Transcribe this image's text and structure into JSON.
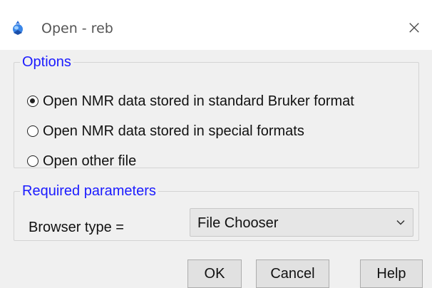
{
  "window": {
    "title": "Open - reb",
    "close_glyph": "×"
  },
  "options": {
    "legend": "Options",
    "radios": [
      {
        "label": "Open NMR data stored in standard Bruker format",
        "checked": true
      },
      {
        "label": "Open NMR data stored in special formats",
        "checked": false
      },
      {
        "label": "Open other file",
        "checked": false
      }
    ]
  },
  "params": {
    "legend": "Required parameters",
    "browser_label": "Browser type =",
    "browser_value": "File Chooser"
  },
  "buttons": {
    "ok": "OK",
    "cancel": "Cancel",
    "help": "Help"
  },
  "colors": {
    "legend": "#1b1bff",
    "background": "#f0f0f0"
  },
  "icons": {
    "app": "topspin-app-icon",
    "close": "close-icon",
    "dropdown": "chevron-down-icon"
  }
}
